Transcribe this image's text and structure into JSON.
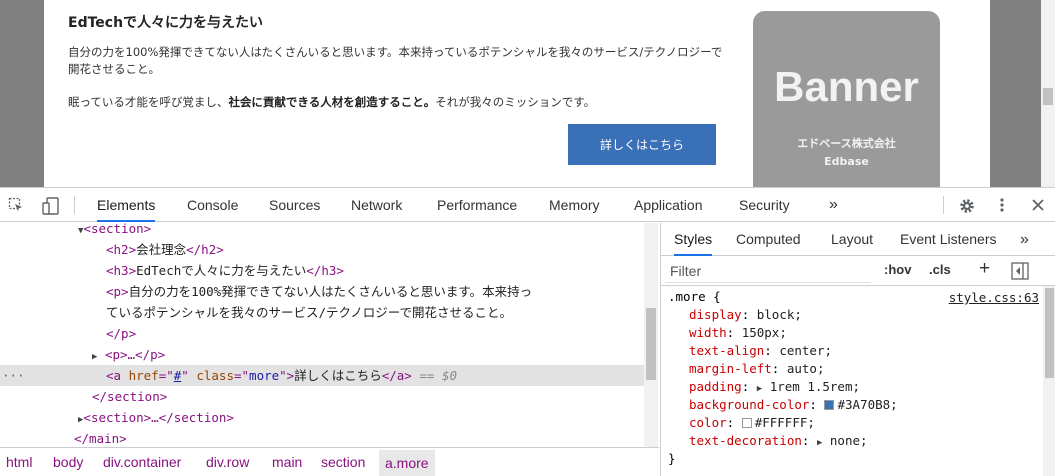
{
  "page": {
    "heading": "EdTechで人々に力を与えたい",
    "paragraph1": "自分の力を100%発揮できてない人はたくさんいると思います。本来持っているポテンシャルを我々のサービス/テクノロジーで開花させること。",
    "paragraph2_before": "眠っている才能を呼び覚まし、",
    "paragraph2_bold": "社会に貢献できる人材を創造すること。",
    "paragraph2_after": "それが我々のミッションです。",
    "more_button": "詳しくはこちら",
    "banner": {
      "title": "Banner",
      "company": "エドベース株式会社",
      "company_en": "Edbase"
    }
  },
  "devtools": {
    "tabs": [
      {
        "label": "Elements"
      },
      {
        "label": "Console"
      },
      {
        "label": "Sources"
      },
      {
        "label": "Network"
      },
      {
        "label": "Performance"
      },
      {
        "label": "Memory"
      },
      {
        "label": "Application"
      },
      {
        "label": "Security"
      }
    ],
    "more_tabs": "»",
    "active_tab": "Elements",
    "dom": {
      "section_open": "<section>",
      "h2_text": "会社理念",
      "h3_text": "EdTechで人々に力を与えたい",
      "p_text_line1": "自分の力を100%発揮できてない人はたくさんいると思います。本来持っ",
      "p_text_line2": "ているポテンシャルを我々のサービス/テクノロジーで開花させること。",
      "p_close": "</p>",
      "p_collapsed": "<p>…</p>",
      "a_href": "#",
      "a_class": "more",
      "a_text": "詳しくはこちら",
      "dollar0": "== $0",
      "section_close": "</section>",
      "section_collapsed": "<section>…</section>",
      "main_close": "</main>",
      "dots": "···"
    },
    "breadcrumbs": [
      "html",
      "body",
      "div.container",
      "div.row",
      "main",
      "section",
      "a.more"
    ],
    "styles": {
      "tabs": [
        "Styles",
        "Computed",
        "Layout",
        "Event Listeners"
      ],
      "more_tabs": "»",
      "filter_placeholder": "Filter",
      "hov": ":hov",
      "cls": ".cls",
      "plus": "+",
      "selector": ".more {",
      "source": "style.css:63",
      "props": [
        {
          "name": "display",
          "value": "block;"
        },
        {
          "name": "width",
          "value": "150px;"
        },
        {
          "name": "text-align",
          "value": "center;"
        },
        {
          "name": "margin-left",
          "value": "auto;"
        },
        {
          "name": "padding",
          "value": "1rem 1.5rem;"
        },
        {
          "name": "background-color",
          "value": "#3A70B8;"
        },
        {
          "name": "color",
          "value": "#FFFFFF;"
        },
        {
          "name": "text-decoration",
          "value": "none;"
        }
      ],
      "close": "}",
      "swatch_bg": "#3A70B8",
      "swatch_color": "#FFFFFF"
    }
  }
}
